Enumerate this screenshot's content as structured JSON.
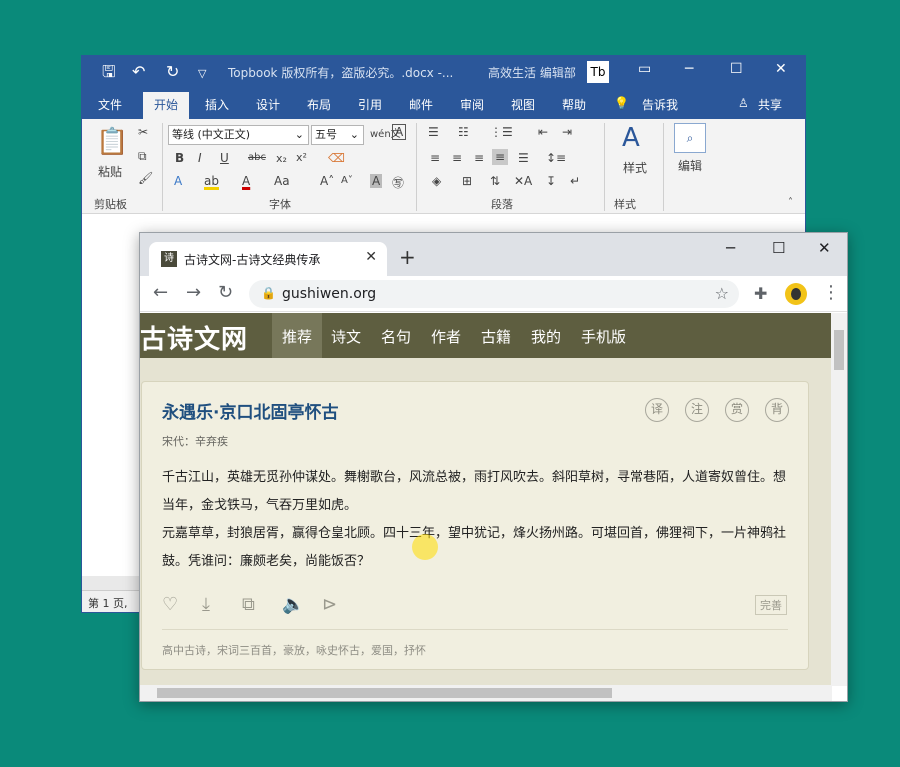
{
  "word": {
    "doc_title": "Topbook 版权所有，盗版必究。.docx  -...",
    "user": "高效生活 编辑部",
    "badge": "Tb",
    "tabs": [
      "文件",
      "开始",
      "插入",
      "设计",
      "布局",
      "引用",
      "邮件",
      "审阅",
      "视图",
      "帮助",
      "告诉我",
      "共享"
    ],
    "ribbon": {
      "paste": "粘贴",
      "font_name": "等线 (中文正文)",
      "font_size": "五号",
      "styles": "样式",
      "edit": "编辑",
      "groups": [
        "剪贴板",
        "字体",
        "段落",
        "样式"
      ]
    },
    "status": "第 1 页,"
  },
  "chrome": {
    "tab_title": "古诗文网-古诗文经典传承",
    "favicon": "诗",
    "url": "gushiwen.org"
  },
  "site": {
    "logo": "古诗文网",
    "nav": [
      "推荐",
      "诗文",
      "名句",
      "作者",
      "古籍",
      "我的",
      "手机版"
    ],
    "poem": {
      "title": "永遇乐·京口北固亭怀古",
      "author": "宋代：辛弃疾",
      "lines": [
        "千古江山，英雄无觅孙仲谋处。舞榭歌台，风流总被，雨打风吹去。斜阳草树，寻常巷陌，人道寄奴曾住。想当年，金戈铁马，气吞万里如虎。",
        "元嘉草草，封狼居胥，赢得仓皇北顾。四十三年，望中犹记，烽火扬州路。可堪回首，佛狸祠下，一片神鸦社鼓。凭谁问：廉颇老矣，尚能饭否？"
      ],
      "circles": [
        "译",
        "注",
        "赏",
        "背"
      ],
      "perfect": "完善",
      "tags": "高中古诗，宋词三百首，豪放，咏史怀古，爱国，抒怀"
    }
  }
}
